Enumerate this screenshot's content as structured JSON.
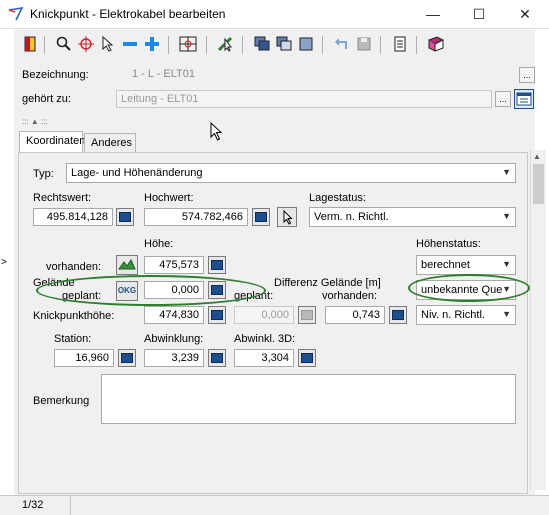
{
  "window": {
    "title": "Knickpunkt - Elektrokabel bearbeiten",
    "minimize": "—",
    "maximize": "☐",
    "close": "✕"
  },
  "header": {
    "bezeichnung_label": "Bezeichnung:",
    "bezeichnung_value": "1 - L - ELT01",
    "gehoert_label": "gehört zu:",
    "gehoert_value": "Leitung - ELT01",
    "dots": "...",
    "splitter": "::: ▲ :::"
  },
  "tabs": [
    {
      "label": "Koordinaten"
    },
    {
      "label": "Anderes"
    }
  ],
  "form": {
    "typ_label": "Typ:",
    "typ_value": "Lage- und Höhenänderung",
    "rechtswert_label": "Rechtswert:",
    "rechtswert_value": "495.814,128",
    "hochwert_label": "Hochwert:",
    "hochwert_value": "574.782,466",
    "lagestatus_label": "Lagestatus:",
    "lagestatus_value": "Verm. n. Richtl.",
    "hoehe_label": "Höhe:",
    "hoehenstatus_label": "Höhenstatus:",
    "vorhanden_label": "vorhanden:",
    "vorhanden_value": "475,573",
    "hoehenstatus_value": "berechnet",
    "gelaende_label": "Gelände",
    "geplant_label": "geplant:",
    "geplant_value": "0,000",
    "geplant2_label": "geplant:",
    "differenz_label": "Differenz Gelände [m]",
    "differenz_vorhanden_label": "vorhanden:",
    "status2_value": "unbekannte Que",
    "okg_icon_text": "OKG",
    "knickpunkthoehe_label": "Knickpunkthöhe:",
    "knickpunkthoehe_value": "474,830",
    "geplant_diff_value": "0,000",
    "differenz_value": "0,743",
    "status3_value": "Niv. n. Richtl.",
    "station_label": "Station:",
    "station_value": "16,960",
    "abwinklung_label": "Abwinklung:",
    "abwinklung_value": "3,239",
    "abwinkl3d_label": "Abwinkl. 3D:",
    "abwinkl3d_value": "3,304",
    "bemerkung_label": "Bemerkung",
    "bemerkung_value": ""
  },
  "statusbar": {
    "record": "1/32"
  },
  "colors": {
    "accent": "#1d4f8f",
    "highlight": "#2f7d2f"
  }
}
